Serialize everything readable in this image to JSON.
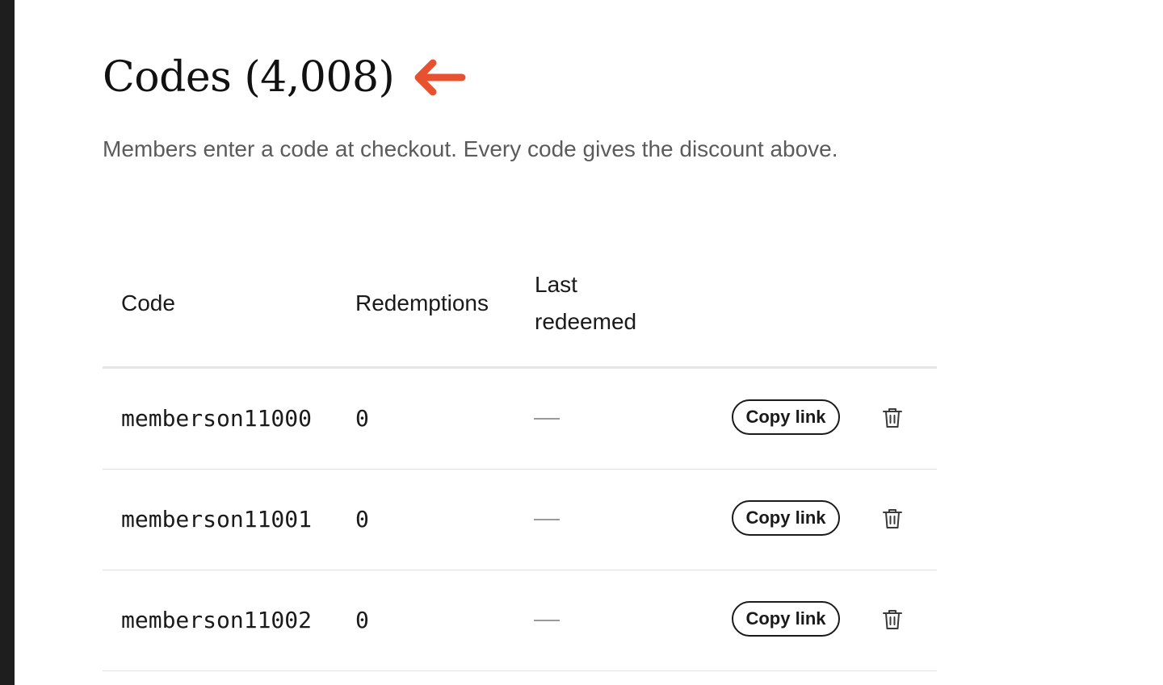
{
  "header": {
    "title": "Codes (4,008)",
    "description": "Members enter a code at checkout. Every code gives the discount above.",
    "arrow_icon": "arrow-left-icon",
    "arrow_color": "#e8512f"
  },
  "table": {
    "columns": {
      "code": "Code",
      "redemptions": "Redemptions",
      "last_redeemed": "Last redeemed"
    },
    "rows": [
      {
        "code": "memberson11000",
        "redemptions": "0",
        "last_redeemed": "—",
        "copy_label": "Copy link",
        "delete_icon": "trash-icon"
      },
      {
        "code": "memberson11001",
        "redemptions": "0",
        "last_redeemed": "—",
        "copy_label": "Copy link",
        "delete_icon": "trash-icon"
      },
      {
        "code": "memberson11002",
        "redemptions": "0",
        "last_redeemed": "—",
        "copy_label": "Copy link",
        "delete_icon": "trash-icon"
      }
    ]
  }
}
